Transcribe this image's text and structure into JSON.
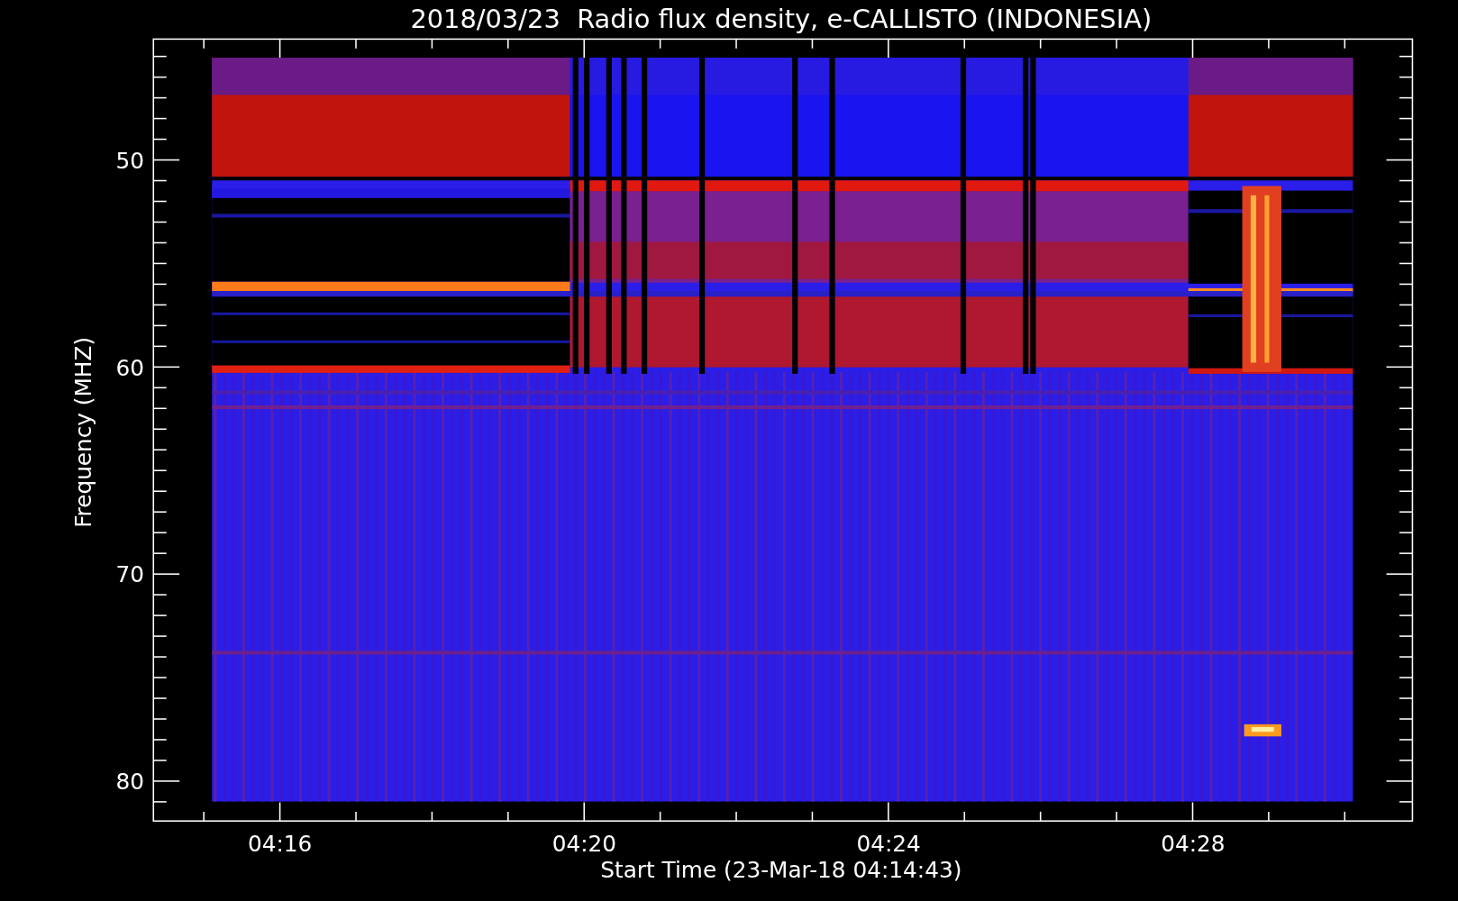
{
  "title": "2018/03/23  Radio flux density, e-CALLISTO (INDONESIA)",
  "y_axis": {
    "label": "Frequency (MHZ)",
    "ticks": [
      "50",
      "60",
      "70",
      "80"
    ]
  },
  "x_axis": {
    "label": "Start Time (23-Mar-18 04:14:43)",
    "ticks": [
      "04:16",
      "04:20",
      "04:24",
      "04:28"
    ]
  }
}
